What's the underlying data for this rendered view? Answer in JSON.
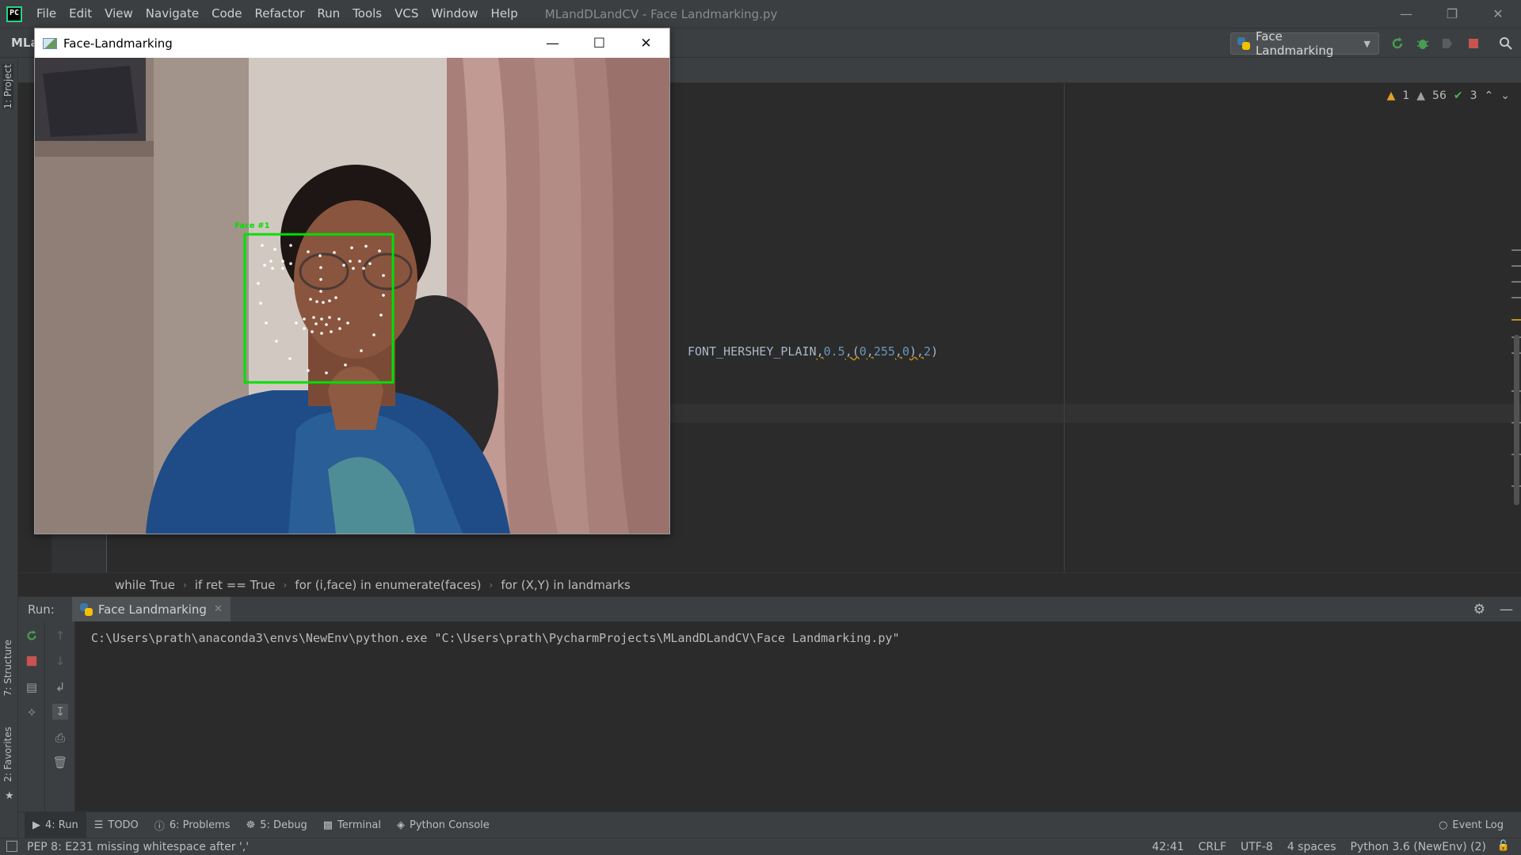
{
  "menubar": {
    "items": [
      "File",
      "Edit",
      "View",
      "Navigate",
      "Code",
      "Refactor",
      "Run",
      "Tools",
      "VCS",
      "Window",
      "Help"
    ],
    "window_title": "MLandDLandCV - Face Landmarking.py"
  },
  "navbar": {
    "project_crumb": "MLa",
    "run_config": "Face Landmarking"
  },
  "left_strip": {
    "project_tab": "1: Project",
    "structure_tab": "7: Structure",
    "favorites_tab": "2: Favorites"
  },
  "editor": {
    "code_visible": "FONT_HERSHEY_PLAIN,0.5,(0,255,0),2)",
    "code_parts": {
      "a": "FONT_HERSHEY_PLAIN",
      "b": ",",
      "c": "0.5",
      "d": ",(",
      "e": "0",
      "f": ",",
      "g": "255",
      "h": ",",
      "i": "0",
      "j": "),",
      "k": "2",
      "l": ")"
    },
    "inspections": {
      "errors": "1",
      "warnings": "56",
      "weak": "3"
    }
  },
  "breadcrumbs": [
    "while True",
    "if ret == True",
    "for (i,face) in enumerate(faces)",
    "for (X,Y) in landmarks"
  ],
  "run_panel": {
    "label": "Run:",
    "tab": "Face Landmarking",
    "console_output": "C:\\Users\\prath\\anaconda3\\envs\\NewEnv\\python.exe \"C:\\Users\\prath\\PycharmProjects\\MLandDLandCV\\Face Landmarking.py\""
  },
  "bottom_tools": {
    "run": "4: Run",
    "todo": "TODO",
    "problems": "6: Problems",
    "debug": "5: Debug",
    "terminal": "Terminal",
    "python_console": "Python Console",
    "event_log": "Event Log"
  },
  "statusbar": {
    "message": "PEP 8: E231 missing whitespace after ','",
    "position": "42:41",
    "line_sep": "CRLF",
    "encoding": "UTF-8",
    "indent": "4 spaces",
    "interpreter": "Python 3.6 (NewEnv) (2)"
  },
  "cv_window": {
    "title": "Face-Landmarking",
    "face_label": "Face #1",
    "box_color": "#00e000",
    "landmark_color": "#ffffff"
  },
  "colors": {
    "ide_bg": "#2b2b2b",
    "panel_bg": "#3c3f41",
    "run_green": "#499c54",
    "stop_red": "#c75450"
  }
}
